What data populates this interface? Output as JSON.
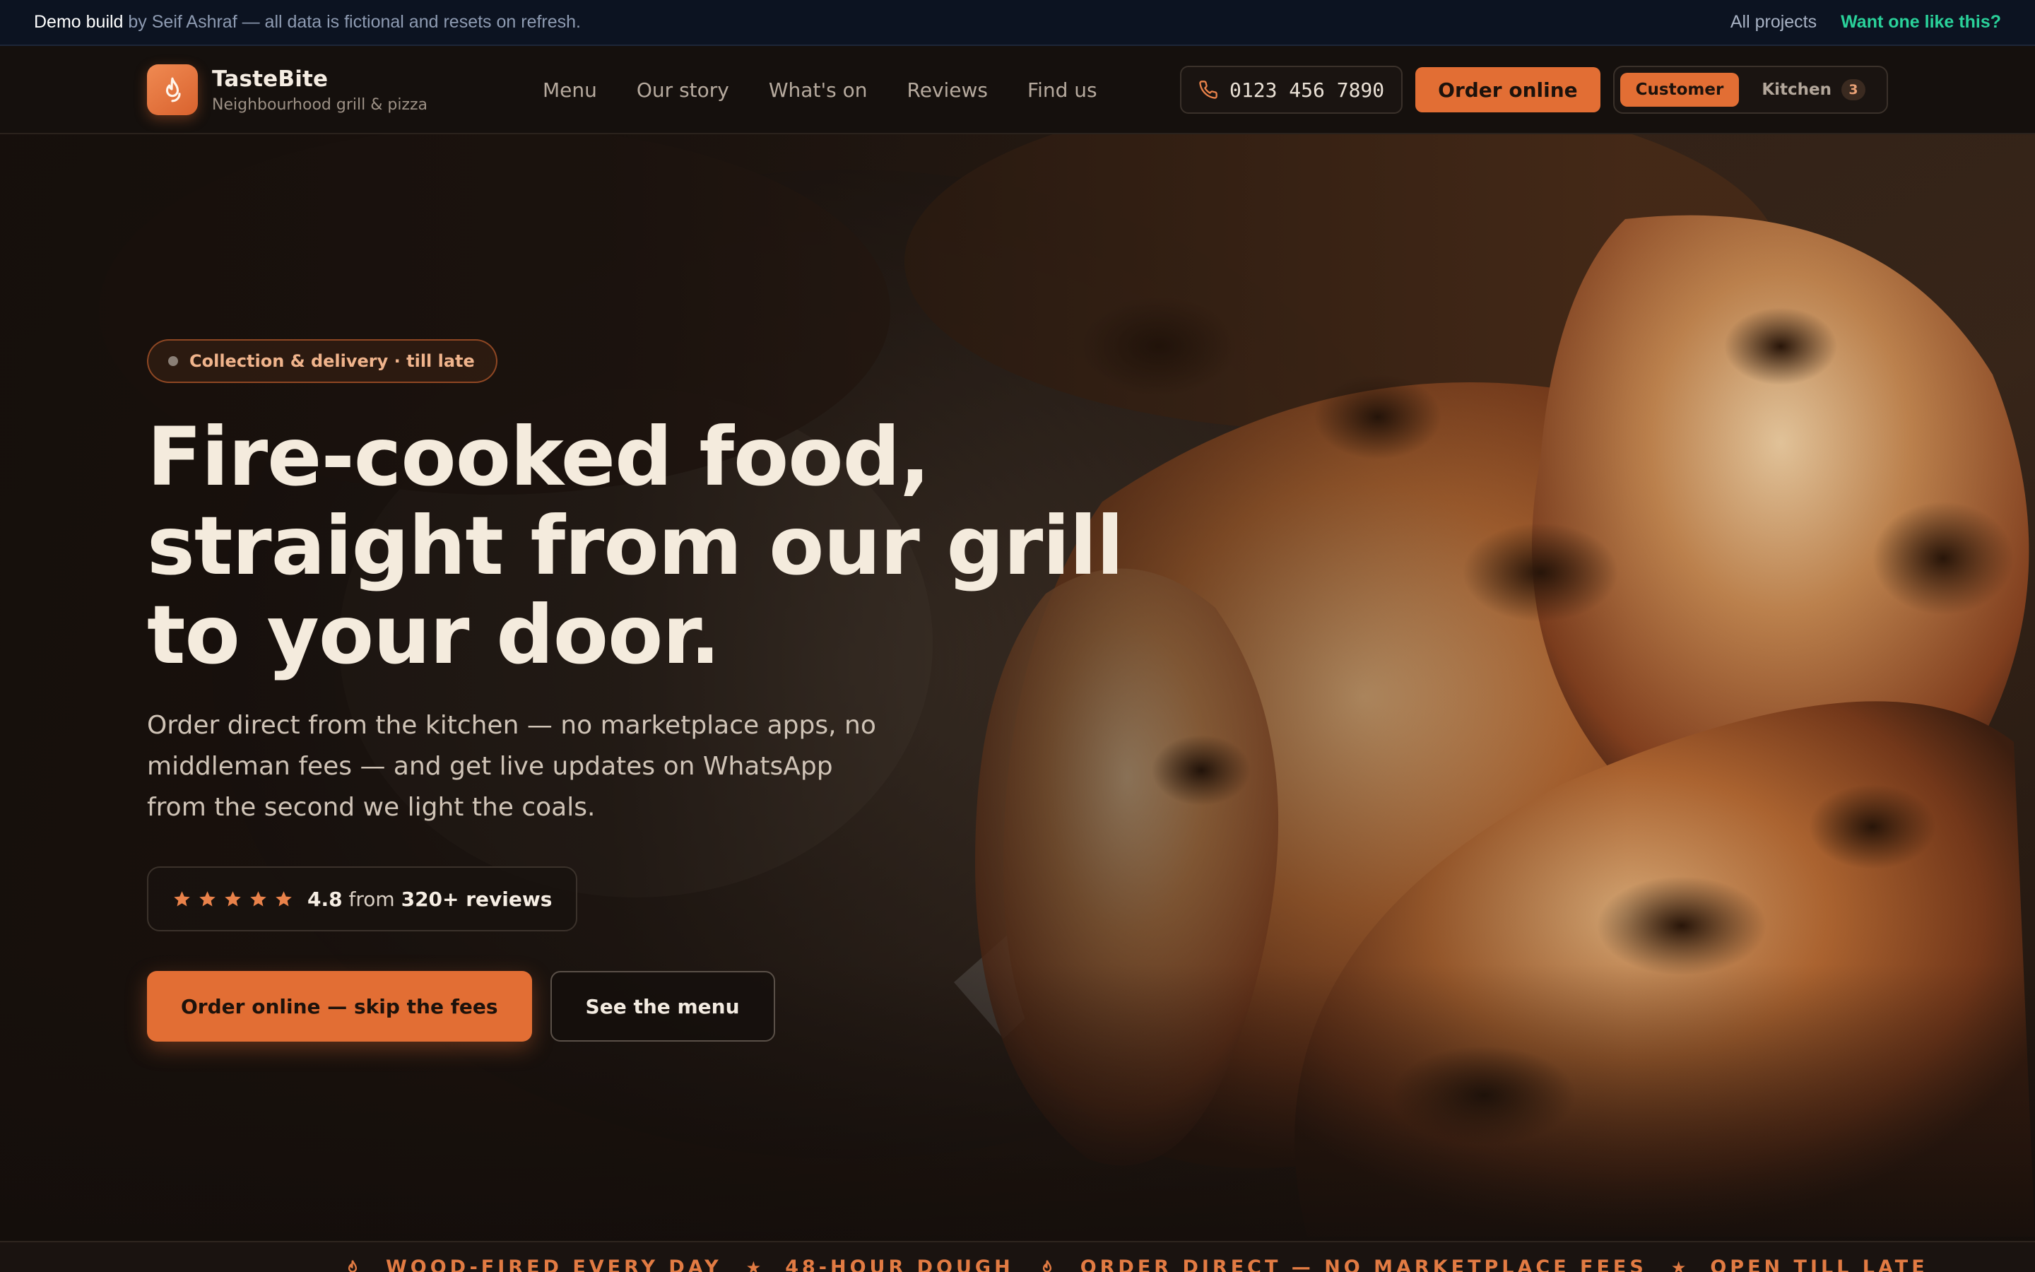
{
  "demo_bar": {
    "label_bold": "Demo build",
    "label_rest": " by Seif Ashraf — all data is fictional and resets on refresh.",
    "all_projects": "All projects",
    "cta": "Want one like this?"
  },
  "brand": {
    "name": "TasteBite",
    "tagline": "Neighbourhood grill & pizza",
    "icon": "flame-icon"
  },
  "nav": {
    "links": [
      "Menu",
      "Our story",
      "What's on",
      "Reviews",
      "Find us"
    ],
    "phone": "0123 456 7890",
    "order_button": "Order online",
    "modes": {
      "customer": "Customer",
      "kitchen": "Kitchen",
      "kitchen_count": "3"
    }
  },
  "hero": {
    "chip": "Collection & delivery · till late",
    "headline": [
      "Fire-cooked food,",
      "straight from our grill",
      "to your door."
    ],
    "lede": "Order direct from the kitchen — no marketplace apps, no middleman fees — and get live updates on WhatsApp from the second we light the coals.",
    "rating": {
      "value": "4.8",
      "from": "from",
      "count": "320+ reviews",
      "stars": 5
    },
    "primary_cta": "Order online — skip the fees",
    "secondary_cta": "See the menu"
  },
  "ticker": {
    "items": [
      "WOOD-FIRED EVERY DAY",
      "48-HOUR DOUGH",
      "ORDER DIRECT — NO MARKETPLACE FEES",
      "OPEN TILL LATE"
    ]
  },
  "colors": {
    "accent": "#e26e34",
    "background": "#140f0c",
    "demo_bar": "#0c1321",
    "demo_cta": "#2ad19a"
  }
}
